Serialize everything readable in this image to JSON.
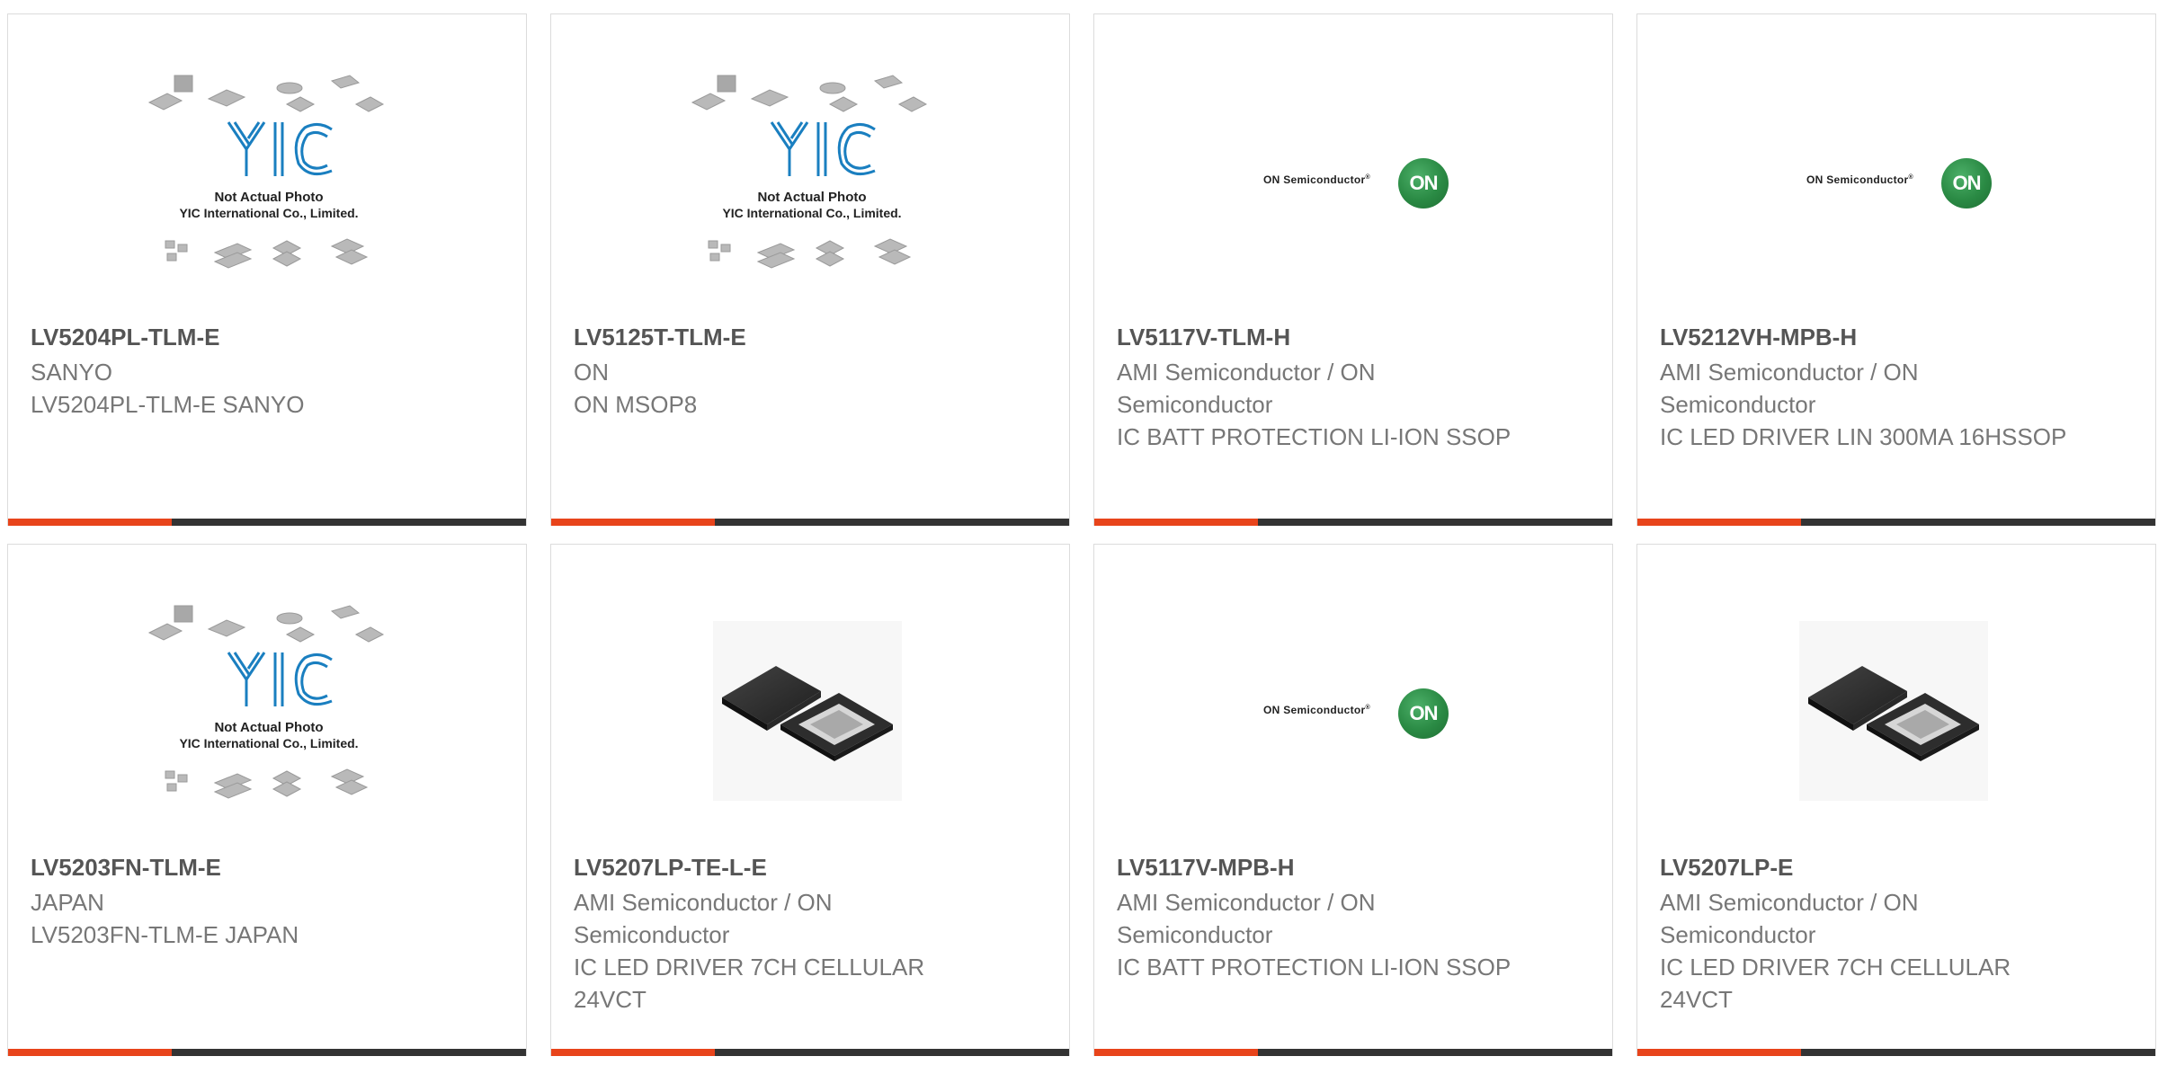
{
  "cards": [
    {
      "name": "LV5204PL-TLM-E",
      "manufacturer": "SANYO",
      "description": "LV5204PL-TLM-E SANYO",
      "image": "yic-placeholder"
    },
    {
      "name": "LV5125T-TLM-E",
      "manufacturer": "ON",
      "description": "ON MSOP8",
      "image": "yic-placeholder"
    },
    {
      "name": "LV5117V-TLM-H",
      "manufacturer": "AMI Semiconductor / ON Semiconductor",
      "description": "IC BATT PROTECTION LI-ION SSOP",
      "image": "on-semiconductor-logo"
    },
    {
      "name": "LV5212VH-MPB-H",
      "manufacturer": "AMI Semiconductor / ON Semiconductor",
      "description": "IC LED DRIVER LIN 300MA 16HSSOP",
      "image": "on-semiconductor-logo"
    },
    {
      "name": "LV5203FN-TLM-E",
      "manufacturer": "JAPAN",
      "description": "LV5203FN-TLM-E JAPAN",
      "image": "yic-placeholder"
    },
    {
      "name": "LV5207LP-TE-L-E",
      "manufacturer": "AMI Semiconductor / ON Semiconductor",
      "description": "IC LED DRIVER 7CH CELLULAR 24VCT",
      "image": "qfn-chip-photo"
    },
    {
      "name": "LV5117V-MPB-H",
      "manufacturer": "AMI Semiconductor / ON Semiconductor",
      "description": "IC BATT PROTECTION LI-ION SSOP",
      "image": "on-semiconductor-logo"
    },
    {
      "name": "LV5207LP-E",
      "manufacturer": "AMI Semiconductor / ON Semiconductor",
      "description": "IC LED DRIVER 7CH CELLULAR 24VCT",
      "image": "qfn-chip-photo"
    }
  ],
  "yic": {
    "line1": "Not Actual Photo",
    "line2": "YIC International Co., Limited.",
    "logo": "YIC"
  },
  "onlogo": {
    "text": "ON Semiconductor",
    "mark": "ON"
  },
  "colors": {
    "accent": "#e8441b",
    "bar": "#333333",
    "on_green": "#2a8a44",
    "yic_blue": "#1a7fc0"
  }
}
